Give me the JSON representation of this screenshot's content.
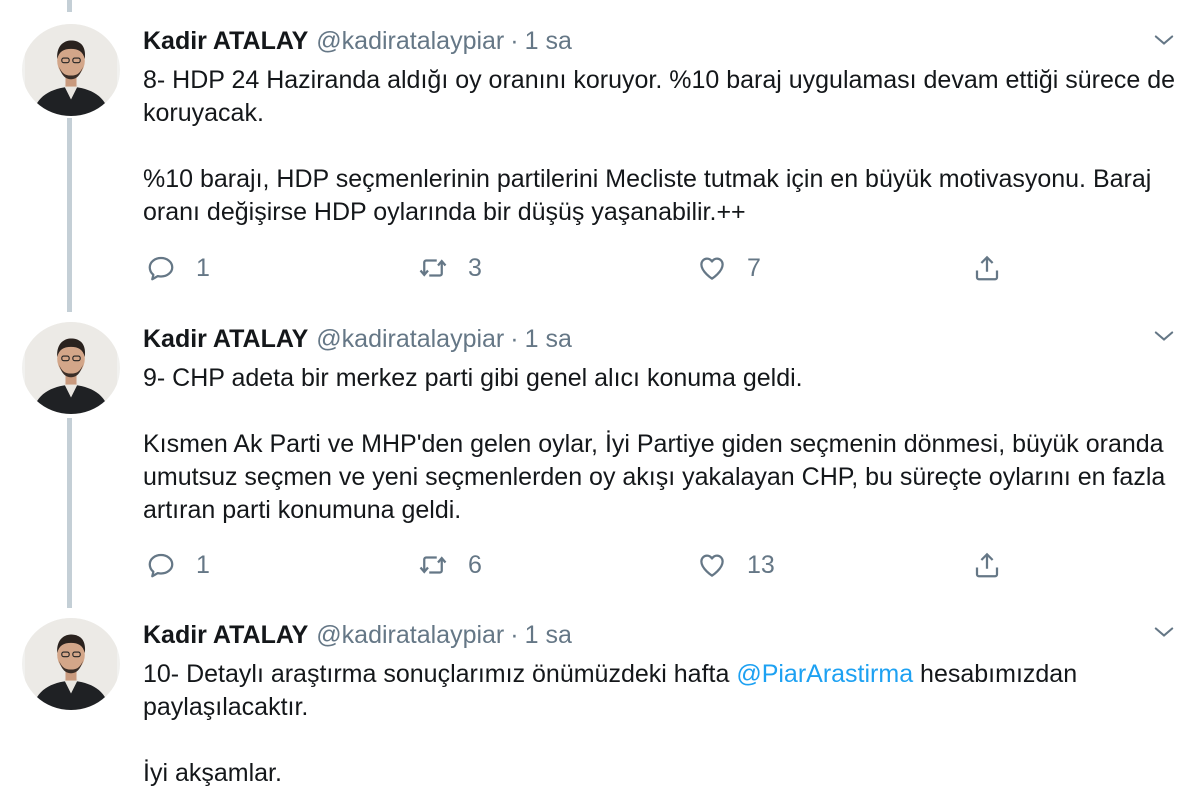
{
  "tweets": [
    {
      "name": "Kadir ATALAY",
      "handle": "@kadiratalaypiar",
      "separator": "·",
      "time": "1 sa",
      "paragraphs": [
        "8- HDP 24 Haziranda aldığı oy oranını koruyor. %10 baraj uygulaması devam ettiği sürece de koruyacak.",
        "%10 barajı, HDP seçmenlerinin partilerini Mecliste tutmak için en büyük motivasyonu. Baraj oranı değişirse HDP oylarında bir düşüş yaşanabilir.++"
      ],
      "replies": "1",
      "retweets": "3",
      "likes": "7"
    },
    {
      "name": "Kadir ATALAY",
      "handle": "@kadiratalaypiar",
      "separator": "·",
      "time": "1 sa",
      "paragraphs": [
        "9- CHP adeta bir merkez parti gibi genel alıcı konuma geldi.",
        "Kısmen Ak Parti ve MHP'den gelen oylar, İyi Partiye giden seçmenin dönmesi, büyük oranda umutsuz seçmen ve yeni seçmenlerden oy akışı yakalayan CHP, bu süreçte oylarını en fazla artıran parti konumuna geldi."
      ],
      "replies": "1",
      "retweets": "6",
      "likes": "13"
    },
    {
      "name": "Kadir ATALAY",
      "handle": "@kadiratalaypiar",
      "separator": "·",
      "time": "1 sa",
      "para1_before": "10- Detaylı araştırma sonuçlarımız önümüzdeki hafta ",
      "mention": "@PiarArastirma",
      "para1_after": " hesabımızdan paylaşılacaktır.",
      "para2": "İyi akşamlar."
    }
  ],
  "icons": {
    "reply": "reply-icon",
    "retweet": "retweet-icon",
    "like": "like-icon",
    "share": "share-icon",
    "caret": "chevron-down-icon"
  },
  "colors": {
    "text": "#14171a",
    "muted": "#657786",
    "link": "#1da1f2",
    "thread_line": "#c4cfd6"
  }
}
